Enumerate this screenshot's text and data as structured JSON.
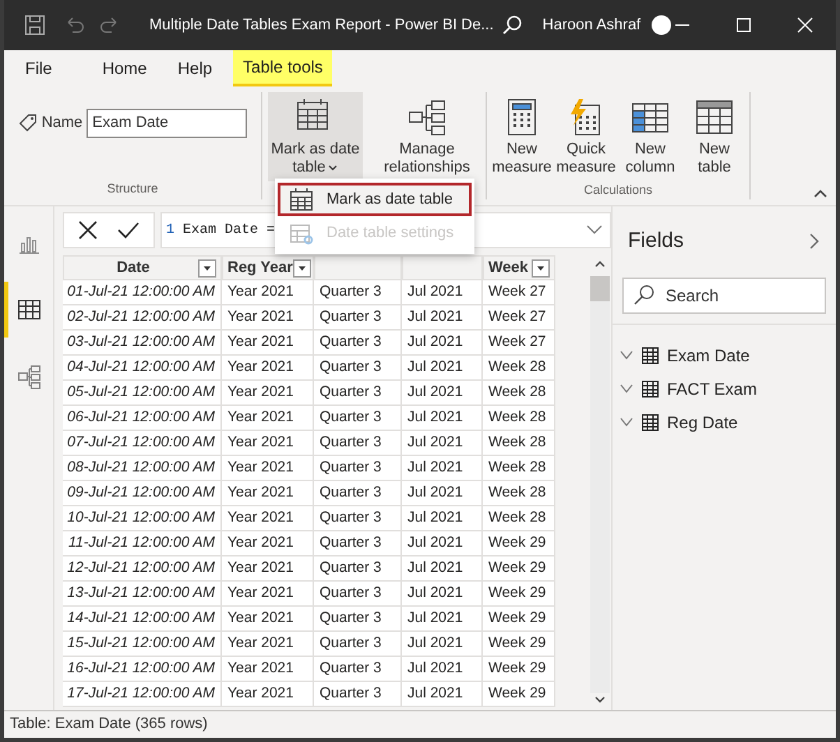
{
  "window": {
    "title": "Multiple Date Tables Exam Report - Power BI De...",
    "user": "Haroon Ashraf"
  },
  "ribbon_tabs": [
    {
      "label": "File",
      "selected": false
    },
    {
      "label": "Home",
      "selected": false
    },
    {
      "label": "Help",
      "selected": false
    },
    {
      "label": "Table tools",
      "selected": true
    }
  ],
  "ribbon": {
    "structure": {
      "name_label": "Name",
      "name_value": "Exam Date",
      "group_label": "Structure"
    },
    "buttons": [
      {
        "kind": "date",
        "label": "Mark as date table",
        "pressed": true
      },
      {
        "kind": "relationships",
        "label": "Manage relationships",
        "pressed": false
      }
    ],
    "calculations": {
      "group_label": "Calculations",
      "buttons": [
        {
          "kind": "measure",
          "label": "New measure"
        },
        {
          "kind": "quick",
          "label": "Quick measure"
        },
        {
          "kind": "column",
          "label": "New column"
        },
        {
          "kind": "table",
          "label": "New table"
        }
      ]
    }
  },
  "menu": [
    {
      "label": "Mark as date table",
      "disabled": false,
      "highlighted": true
    },
    {
      "label": "Date table settings",
      "disabled": true,
      "highlighted": false
    }
  ],
  "left_rail": [
    {
      "kind": "report",
      "selected": false
    },
    {
      "kind": "data",
      "selected": true
    },
    {
      "kind": "model",
      "selected": false
    }
  ],
  "formula": {
    "line": "1",
    "text": "Exam Date ="
  },
  "table": {
    "columns": [
      {
        "label": "Date"
      },
      {
        "label": "Reg Year"
      },
      {},
      {},
      {
        "label": "Week"
      }
    ],
    "rows": [
      [
        "01-Jul-21 12:00:00 AM",
        "Year 2021",
        "Quarter 3",
        "Jul 2021",
        "Week 27"
      ],
      [
        "02-Jul-21 12:00:00 AM",
        "Year 2021",
        "Quarter 3",
        "Jul 2021",
        "Week 27"
      ],
      [
        "03-Jul-21 12:00:00 AM",
        "Year 2021",
        "Quarter 3",
        "Jul 2021",
        "Week 27"
      ],
      [
        "04-Jul-21 12:00:00 AM",
        "Year 2021",
        "Quarter 3",
        "Jul 2021",
        "Week 28"
      ],
      [
        "05-Jul-21 12:00:00 AM",
        "Year 2021",
        "Quarter 3",
        "Jul 2021",
        "Week 28"
      ],
      [
        "06-Jul-21 12:00:00 AM",
        "Year 2021",
        "Quarter 3",
        "Jul 2021",
        "Week 28"
      ],
      [
        "07-Jul-21 12:00:00 AM",
        "Year 2021",
        "Quarter 3",
        "Jul 2021",
        "Week 28"
      ],
      [
        "08-Jul-21 12:00:00 AM",
        "Year 2021",
        "Quarter 3",
        "Jul 2021",
        "Week 28"
      ],
      [
        "09-Jul-21 12:00:00 AM",
        "Year 2021",
        "Quarter 3",
        "Jul 2021",
        "Week 28"
      ],
      [
        "10-Jul-21 12:00:00 AM",
        "Year 2021",
        "Quarter 3",
        "Jul 2021",
        "Week 28"
      ],
      [
        "11-Jul-21 12:00:00 AM",
        "Year 2021",
        "Quarter 3",
        "Jul 2021",
        "Week 29"
      ],
      [
        "12-Jul-21 12:00:00 AM",
        "Year 2021",
        "Quarter 3",
        "Jul 2021",
        "Week 29"
      ],
      [
        "13-Jul-21 12:00:00 AM",
        "Year 2021",
        "Quarter 3",
        "Jul 2021",
        "Week 29"
      ],
      [
        "14-Jul-21 12:00:00 AM",
        "Year 2021",
        "Quarter 3",
        "Jul 2021",
        "Week 29"
      ],
      [
        "15-Jul-21 12:00:00 AM",
        "Year 2021",
        "Quarter 3",
        "Jul 2021",
        "Week 29"
      ],
      [
        "16-Jul-21 12:00:00 AM",
        "Year 2021",
        "Quarter 3",
        "Jul 2021",
        "Week 29"
      ],
      [
        "17-Jul-21 12:00:00 AM",
        "Year 2021",
        "Quarter 3",
        "Jul 2021",
        "Week 29"
      ]
    ]
  },
  "fields": {
    "title": "Fields",
    "search_placeholder": "Search",
    "items": [
      {
        "label": "Exam Date",
        "expanded": false
      },
      {
        "label": "FACT Exam",
        "expanded": false
      },
      {
        "label": "Reg Date",
        "expanded": false
      }
    ]
  },
  "status_bar": "Table: Exam Date (365 rows)"
}
